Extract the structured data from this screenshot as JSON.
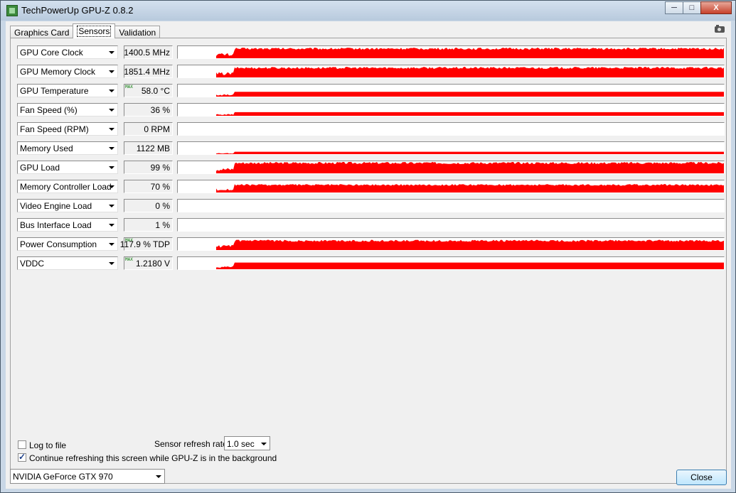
{
  "window": {
    "title": "TechPowerUp GPU-Z 0.8.2",
    "minimize": "─",
    "maximize": "□",
    "close": "X"
  },
  "tabs": [
    {
      "label": "Graphics Card"
    },
    {
      "label": "Sensors",
      "active": true
    },
    {
      "label": "Validation"
    }
  ],
  "graph_color": "#ff0000",
  "sensors": [
    {
      "name": "GPU Core Clock",
      "value": "1400.5 MHz",
      "max": "",
      "level": 0.88
    },
    {
      "name": "GPU Memory Clock",
      "value": "1851.4 MHz",
      "max": "",
      "level": 0.88
    },
    {
      "name": "GPU Temperature",
      "value": "58.0 °C",
      "max": "MAX",
      "level": 0.4
    },
    {
      "name": "Fan Speed (%)",
      "value": "36 %",
      "max": "",
      "level": 0.3
    },
    {
      "name": "Fan Speed (RPM)",
      "value": "0 RPM",
      "max": "",
      "level": 0
    },
    {
      "name": "Memory Used",
      "value": "1122 MB",
      "max": "",
      "level": 0.2
    },
    {
      "name": "GPU Load",
      "value": "99 %",
      "max": "",
      "level": 0.95
    },
    {
      "name": "Memory Controller Load",
      "value": "70 %",
      "max": "",
      "level": 0.7
    },
    {
      "name": "Video Engine Load",
      "value": "0 %",
      "max": "",
      "level": 0
    },
    {
      "name": "Bus Interface Load",
      "value": "1 %",
      "max": "",
      "level": 0
    },
    {
      "name": "Power Consumption",
      "value": "117.9 % TDP",
      "max": "MAX",
      "level": 0.85
    },
    {
      "name": "VDDC",
      "value": "1.2180 V",
      "max": "MAX",
      "level": 0.55
    }
  ],
  "log_to_file": {
    "label": "Log to file",
    "checked": false
  },
  "refresh": {
    "label": "Sensor refresh rate:",
    "value": "1.0 sec"
  },
  "continue_refresh": {
    "label": "Continue refreshing this screen while GPU-Z is in the background",
    "checked": true
  },
  "gpu_select": {
    "value": "NVIDIA GeForce GTX 970"
  },
  "close_button": {
    "label": "Close"
  }
}
